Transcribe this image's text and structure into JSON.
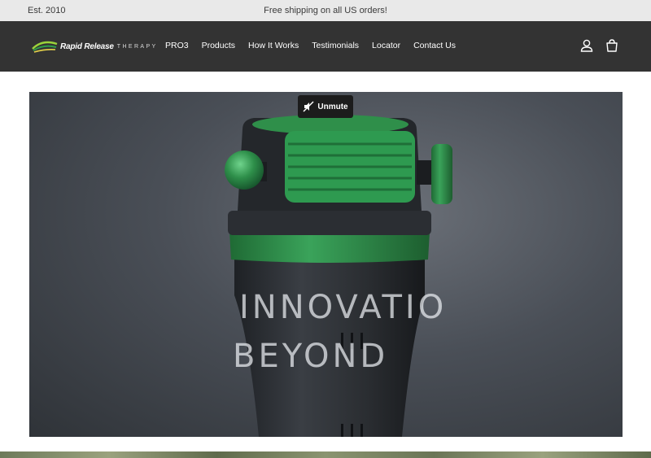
{
  "announcement": {
    "left_text": "Est. 2010",
    "center_text": "Free shipping on all US orders!"
  },
  "header": {
    "logo": {
      "brand": "Rapid Release",
      "sub": "THERAPY"
    },
    "nav": [
      "PRO3",
      "Products",
      "How It Works",
      "Testimonials",
      "Locator",
      "Contact Us"
    ],
    "icons": [
      "account-icon",
      "cart-icon"
    ]
  },
  "hero": {
    "unmute_label": "Unmute",
    "headline_line1": "INNOVATIO",
    "headline_line2": "BEYOND",
    "colors": {
      "accent": "#2f8f4a",
      "device_body": "#2a2d31"
    }
  }
}
